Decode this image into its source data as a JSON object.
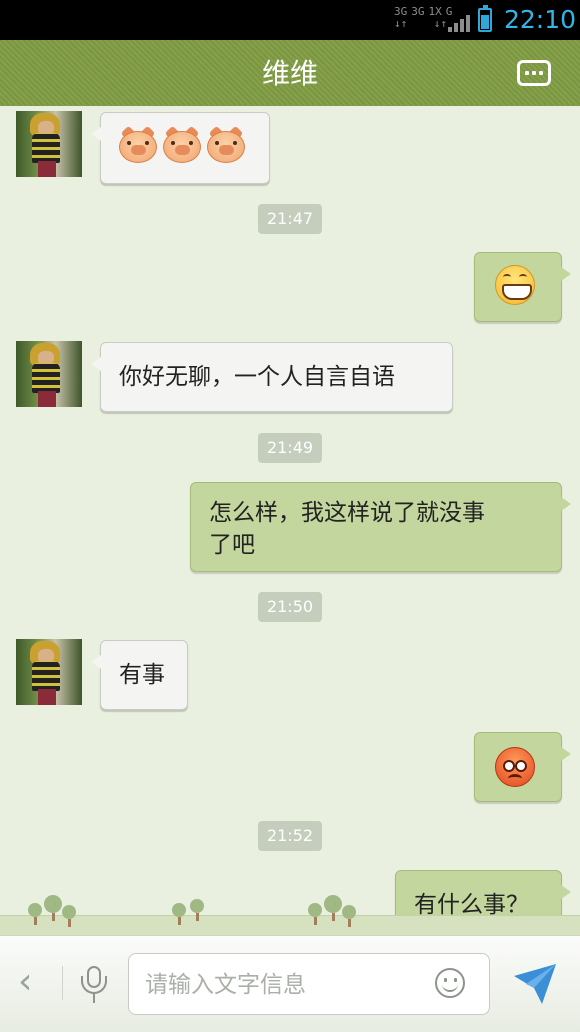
{
  "status_bar": {
    "network_top": [
      "3G",
      "3G",
      "1X",
      "G"
    ],
    "time": "22:10"
  },
  "header": {
    "title": "维维",
    "menu_icon": "more-icon"
  },
  "messages": [
    {
      "side": "left",
      "type": "emoji",
      "content": "pig-emoji x3"
    },
    {
      "side": "time",
      "text": "21:47"
    },
    {
      "side": "right",
      "type": "emoji",
      "content": "grin-emoji"
    },
    {
      "side": "left",
      "type": "text",
      "text": "你好无聊，一个人自言自语"
    },
    {
      "side": "time",
      "text": "21:49"
    },
    {
      "side": "right",
      "type": "text",
      "text_line1": "怎么样，我这样说了就没事",
      "text_line2": "了吧"
    },
    {
      "side": "time",
      "text": "21:50"
    },
    {
      "side": "left",
      "type": "text",
      "text": "有事"
    },
    {
      "side": "right",
      "type": "emoji",
      "content": "angry-emoji"
    },
    {
      "side": "time",
      "text": "21:52"
    },
    {
      "side": "right",
      "type": "text",
      "text": "有什么事？"
    }
  ],
  "input_bar": {
    "back_glyph": "‹",
    "placeholder": "请输入文字信息",
    "value": ""
  },
  "colors": {
    "header": "#7f9b43",
    "chat_bg": "#e9f0df",
    "bubble_right": "#c2d69d",
    "bubble_left": "#f4f5f2",
    "clock": "#33b5e5"
  }
}
